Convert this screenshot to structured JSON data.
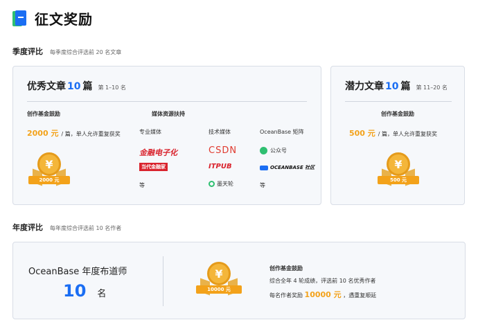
{
  "page": {
    "title": "征文奖励"
  },
  "quarterly": {
    "label": "季度评比",
    "sub": "每季度综合评选前 20 名文章",
    "excellent": {
      "name": "优秀文章",
      "count": "10",
      "unit": "篇",
      "rank": "第 1–10 名",
      "fund_head": "创作基金鼓励",
      "amount": "2000 元",
      "amount_rest": "/ 篇，单人允许重复获奖",
      "medal_label": "2000 元",
      "media_head": "媒体资源扶持",
      "columns": [
        {
          "head": "专业媒体",
          "logos": [
            "金融电子化",
            "当代金融家"
          ],
          "etc": "等"
        },
        {
          "head": "技术媒体",
          "logos": [
            "CSDN",
            "ITPUB",
            "墨天轮"
          ],
          "etc": "等"
        },
        {
          "head": "OceanBase 矩阵",
          "logos": [
            "公众号",
            "OCEANBASE 社区"
          ],
          "etc": "等"
        }
      ]
    },
    "potential": {
      "name": "潜力文章",
      "count": "10",
      "unit": "篇",
      "rank": "第 11–20 名",
      "fund_head": "创作基金鼓励",
      "amount": "500 元",
      "amount_rest": "/ 篇，单人允许重复获奖",
      "medal_label": "500 元"
    }
  },
  "yearly": {
    "label": "年度评比",
    "sub": "每年度综合评选前 10 名作者",
    "title": "OceanBase 年度布道师",
    "count": "10",
    "unit": "名",
    "medal_label": "10000 元",
    "fund_head": "创作基金鼓励",
    "line1": "综合全年 4 轮成绩，评选前 10 名优秀作者",
    "line2_pre": "每名作者奖励",
    "line2_amt": "10000 元",
    "line2_post": "，遇重复顺延"
  },
  "colors": {
    "accent": "#1b6ef3",
    "gold": "#f3a21a",
    "csdn_red": "#e03a2f",
    "finance_red": "#d9232d"
  },
  "icons": [
    "book-icon",
    "yuan-coin-icon",
    "wechat-icon"
  ]
}
